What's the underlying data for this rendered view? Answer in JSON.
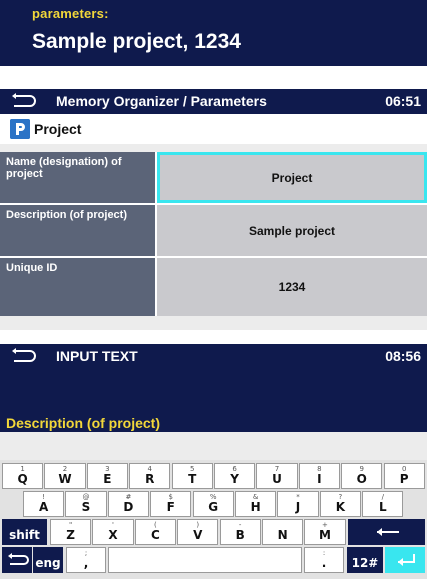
{
  "panel1": {
    "label": "parameters:",
    "value": "Sample project, 1234"
  },
  "panel2": {
    "title": "Memory Organizer / Parameters",
    "time": "06:51",
    "breadcrumb": "Project",
    "rows": [
      {
        "key": "Name (designation) of project",
        "value": "Project"
      },
      {
        "key": "Description (of project)",
        "value": "Sample project"
      },
      {
        "key": "Unique ID",
        "value": "1234"
      }
    ]
  },
  "panel3": {
    "title": "INPUT TEXT",
    "time": "08:56",
    "prompt": "Description (of project)",
    "keyboard": {
      "row1": [
        [
          "1",
          "Q"
        ],
        [
          "2",
          "W"
        ],
        [
          "3",
          "E"
        ],
        [
          "4",
          "R"
        ],
        [
          "5",
          "T"
        ],
        [
          "6",
          "Y"
        ],
        [
          "7",
          "U"
        ],
        [
          "8",
          "I"
        ],
        [
          "9",
          "O"
        ],
        [
          "0",
          "P"
        ]
      ],
      "row2": [
        [
          "!",
          "A"
        ],
        [
          "@",
          "S"
        ],
        [
          "#",
          "D"
        ],
        [
          "$",
          "F"
        ],
        [
          "%",
          "G"
        ],
        [
          "&",
          "H"
        ],
        [
          "*",
          "J"
        ],
        [
          "?",
          "K"
        ],
        [
          "/",
          "L"
        ]
      ],
      "row3": [
        [
          "\"",
          "Z"
        ],
        [
          "'",
          "X"
        ],
        [
          "(",
          "C"
        ],
        [
          ")",
          "V"
        ],
        [
          "-",
          "B"
        ],
        [
          "",
          "N"
        ],
        [
          "+",
          "M"
        ]
      ],
      "shift": "shift",
      "lang": "eng",
      "comma": ",",
      "dot": ".",
      "semi": ";",
      "colon": ":",
      "num": "12#"
    }
  },
  "colors": {
    "navy": "#0f1a4d",
    "accent": "#39e6ef",
    "yellow": "#f2d73a",
    "keyGray": "#5b6478"
  }
}
